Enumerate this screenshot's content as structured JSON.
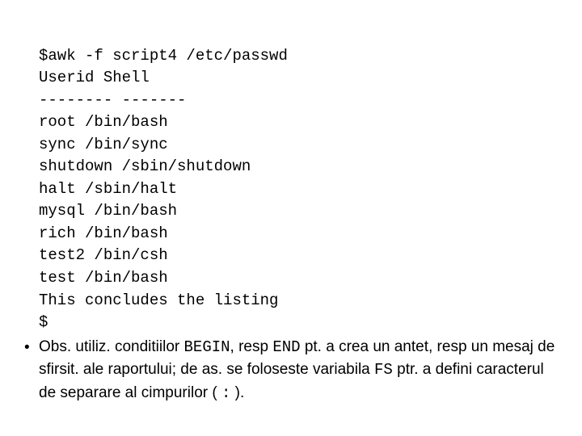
{
  "code": {
    "l01": "$awk -f script4 /etc/passwd",
    "l02": "Userid Shell",
    "l03": "-------- -------",
    "l04": "root /bin/bash",
    "l05": "sync /bin/sync",
    "l06": "shutdown /sbin/shutdown",
    "l07": "halt /sbin/halt",
    "l08": "mysql /bin/bash",
    "l09": "rich /bin/bash",
    "l10": "test2 /bin/csh",
    "l11": "test /bin/bash",
    "l12": "This concludes the listing",
    "l13": "$"
  },
  "bullet": {
    "marker": "•",
    "seg1": "Obs. utiliz. conditiilor ",
    "kw1": "BEGIN",
    "seg2": ", resp ",
    "kw2": "END",
    "seg3": "  pt. a crea un antet, resp un mesaj de sfirsit. ale raportului; de as. se foloseste variabila ",
    "kw3": "FS",
    "seg4": " ptr. a defini caracterul de  separare al cimpurilor ( ",
    "kw4": ":",
    "seg5": " )."
  }
}
